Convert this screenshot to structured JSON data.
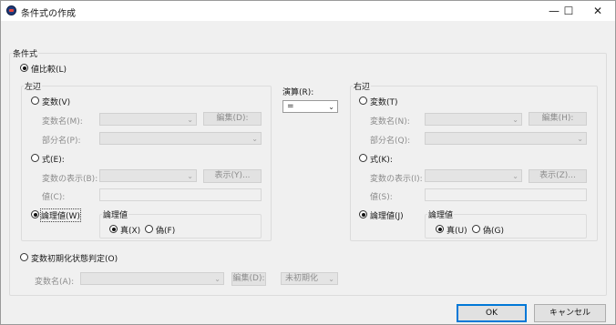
{
  "window": {
    "title": "条件式の作成",
    "min_glyph": "—",
    "max_glyph": "☐",
    "close_glyph": "✕"
  },
  "conditions": {
    "legend": "条件式",
    "value_compare": {
      "label": "値比較(L)",
      "selected": true
    },
    "left": {
      "legend": "左辺",
      "variable": {
        "label": "変数(V)",
        "name_label": "変数名(M):",
        "edit_button": "編集(D):",
        "part_label": "部分名(P):"
      },
      "expression": {
        "label": "式(E):",
        "display_label": "変数の表示(B):",
        "show_button": "表示(Y)...",
        "value_label": "値(C):"
      },
      "logical": {
        "label": "論理値(W)",
        "selected": true,
        "group_label": "論理値",
        "true_label": "真(X)",
        "false_label": "偽(F)",
        "true_selected": true
      }
    },
    "operator": {
      "label": "演算(R):",
      "value": "="
    },
    "right": {
      "legend": "右辺",
      "variable": {
        "label": "変数(T)",
        "name_label": "変数名(N):",
        "edit_button": "編集(H):",
        "part_label": "部分名(Q):"
      },
      "expression": {
        "label": "式(K):",
        "display_label": "変数の表示(I):",
        "show_button": "表示(Z)...",
        "value_label": "値(S):"
      },
      "logical": {
        "label": "論理値(J)",
        "selected": true,
        "group_label": "論理値",
        "true_label": "真(U)",
        "false_label": "偽(G)",
        "true_selected": true
      }
    },
    "init_check": {
      "label": "変数初期化状態判定(O)",
      "name_label": "変数名(A):",
      "edit_button": "編集(D):",
      "state_value": "未初期化"
    }
  },
  "footer": {
    "ok": "OK",
    "cancel": "キャンセル"
  }
}
